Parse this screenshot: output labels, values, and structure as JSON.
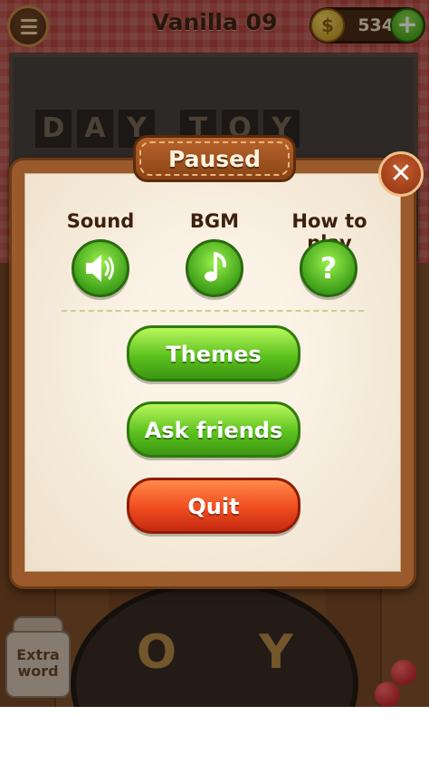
{
  "header": {
    "level_title": "Vanilla 09",
    "coins": "534",
    "coin_symbol": "$",
    "plus_symbol": "+"
  },
  "board": {
    "tiles": [
      "D",
      "A",
      "Y",
      "T",
      "O",
      "Y"
    ]
  },
  "wheel": {
    "letters": [
      "O",
      "Y"
    ]
  },
  "extra_word": {
    "line1": "Extra",
    "line2": "word"
  },
  "dialog": {
    "title": "Paused",
    "close_symbol": "✕",
    "options": [
      {
        "label": "Sound",
        "icon": "speaker-icon"
      },
      {
        "label": "BGM",
        "icon": "music-note-icon"
      },
      {
        "label": "How to play",
        "icon": "question-icon"
      }
    ],
    "buttons": {
      "themes": "Themes",
      "ask_friends": "Ask friends",
      "quit": "Quit"
    }
  },
  "colors": {
    "accent_green": "#5cc21e",
    "quit_red": "#ef4b1f",
    "frame_brown": "#9a5a2b"
  }
}
